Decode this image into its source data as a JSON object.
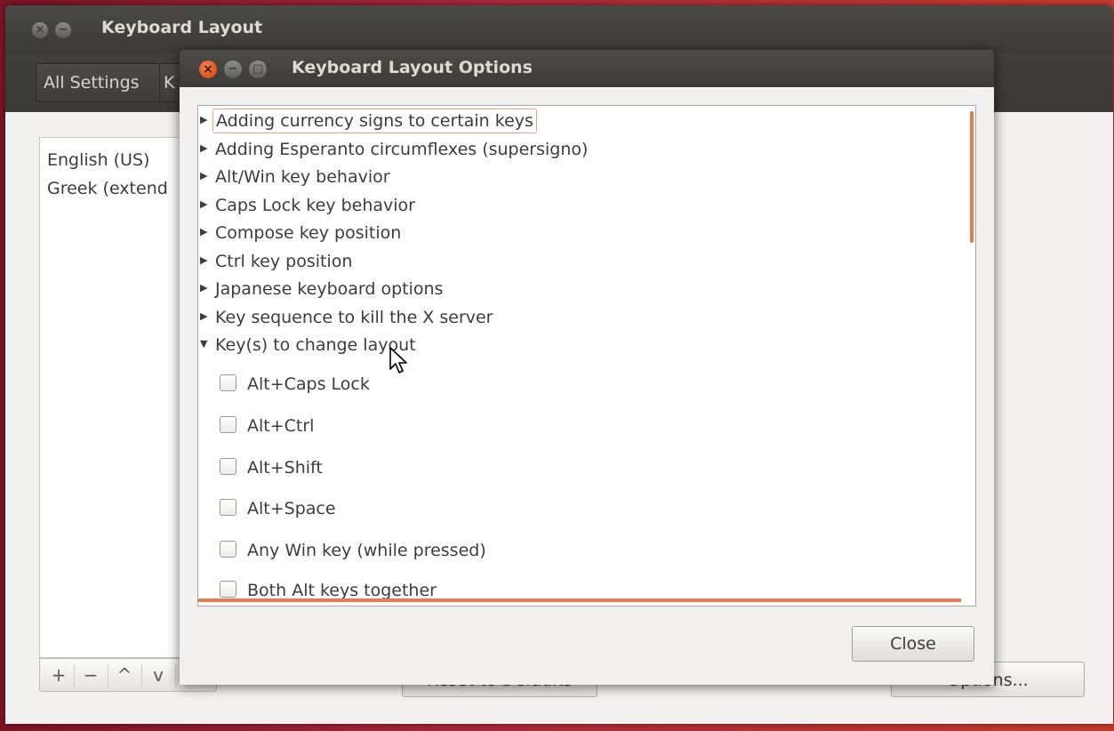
{
  "parent_window": {
    "title": "Keyboard Layout",
    "breadcrumb": {
      "all_settings_label": "All Settings",
      "next_crumb_fragment": "K"
    },
    "layouts": [
      "English (US)",
      "Greek (extend"
    ],
    "toolbar_buttons": [
      "+",
      "−",
      "^",
      "v",
      "▭"
    ],
    "reset_label": "Reset to Defaults",
    "options_label": "Options..."
  },
  "dialog": {
    "title": "Keyboard Layout Options",
    "tree_items": [
      {
        "label": "Adding currency signs to certain keys",
        "expanded": false,
        "focused": true
      },
      {
        "label": "Adding Esperanto circumflexes (supersigno)",
        "expanded": false
      },
      {
        "label": "Alt/Win key behavior",
        "expanded": false
      },
      {
        "label": "Caps Lock key behavior",
        "expanded": false
      },
      {
        "label": "Compose key position",
        "expanded": false
      },
      {
        "label": "Ctrl key position",
        "expanded": false
      },
      {
        "label": "Japanese keyboard options",
        "expanded": false
      },
      {
        "label": "Key sequence to kill the X server",
        "expanded": false
      },
      {
        "label": "Key(s) to change layout",
        "expanded": true
      }
    ],
    "options": [
      {
        "label": "Alt+Caps Lock",
        "checked": false
      },
      {
        "label": "Alt+Ctrl",
        "checked": false
      },
      {
        "label": "Alt+Shift",
        "checked": false
      },
      {
        "label": "Alt+Space",
        "checked": false
      },
      {
        "label": "Any Win key (while pressed)",
        "checked": false
      },
      {
        "label": "Both Alt keys together",
        "checked": false
      }
    ],
    "close_label": "Close"
  },
  "colors": {
    "accent": "#ed764d",
    "titlebar": "#3c3b37",
    "close_button": "#e0501d"
  }
}
